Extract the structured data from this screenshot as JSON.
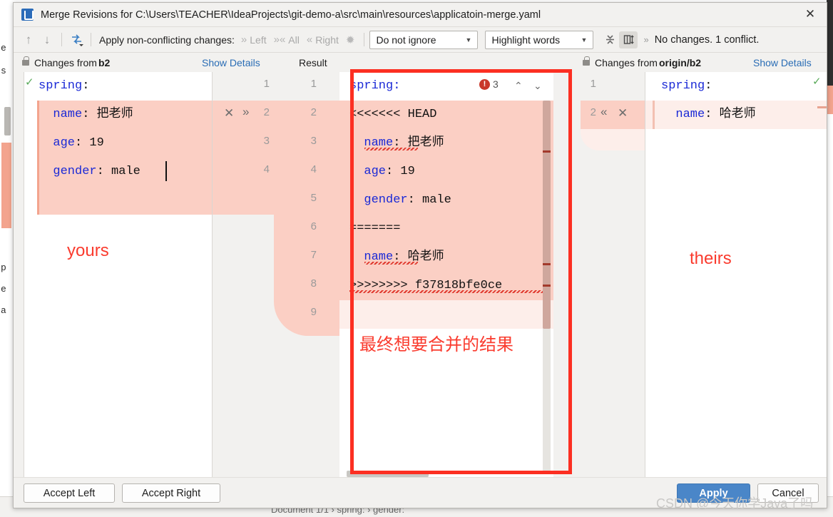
{
  "window": {
    "title": "Merge Revisions for C:\\Users\\TEACHER\\IdeaProjects\\git-demo-a\\src\\main\\resources\\applicatoin-merge.yaml",
    "close_label": "✕",
    "app_icon": "intellij-idea-icon"
  },
  "toolbar": {
    "prev_icon": "↑",
    "next_icon": "↓",
    "apply_all_icon": "⇆",
    "apply_label": "Apply non-conflicting changes:",
    "left_label": "Left",
    "left_icon": "»",
    "all_label": "All",
    "all_icon": "»«",
    "right_label": "Right",
    "right_icon": "«",
    "magic_icon": "magic-wand-icon",
    "ignore_select": "Do not ignore",
    "highlight_select": "Highlight words",
    "collapse_icon": "collapse-unchanged-icon",
    "sync_icon": "synchronize-scroll-icon",
    "overflow_icon": "»",
    "status": "No changes. 1 conflict."
  },
  "headers": {
    "left": {
      "prefix": "Changes from ",
      "branch": "b2",
      "details": "Show Details",
      "lock_icon": "lock-icon"
    },
    "result": "Result",
    "right": {
      "prefix": "Changes from ",
      "branch": "origin/b2",
      "details": "Show Details",
      "lock_icon": "lock-icon"
    }
  },
  "left_pane": {
    "name": "yours",
    "lines": [
      {
        "key": "spring",
        "colon": ":",
        "value": ""
      },
      {
        "key": "  name",
        "colon": ":",
        "value": " 把老师"
      },
      {
        "key": "  age",
        "colon": ":",
        "value": " 19"
      },
      {
        "key": "  gender",
        "colon": ":",
        "value": " male"
      }
    ],
    "line_numbers": [
      "1",
      "2",
      "3",
      "4"
    ],
    "gutter_icons": {
      "remove": "✕",
      "accept_right": "»"
    },
    "annotation": "yours"
  },
  "result_pane": {
    "lines": [
      "spring:",
      "<<<<<<< HEAD",
      "  name: 把老师",
      "  age: 19",
      "  gender: male",
      "=======",
      "  name: 哈老师",
      ">>>>>>>> f37818bfe0ce"
    ],
    "line_numbers": [
      "1",
      "2",
      "3",
      "4",
      "5",
      "6",
      "7",
      "8",
      "9"
    ],
    "error_count": "3",
    "error_icon": "error-icon",
    "nav_up": "⌃",
    "nav_down": "⌄",
    "annotation": "最终想要合并的结果"
  },
  "right_pane": {
    "name": "theirs",
    "lines": [
      {
        "key": "spring",
        "colon": ":",
        "value": ""
      },
      {
        "key": "  name",
        "colon": ":",
        "value": " 哈老师"
      }
    ],
    "line_numbers": [
      "1",
      "2"
    ],
    "gutter_icons": {
      "accept_left": "«",
      "remove": "✕"
    },
    "annotation": "theirs"
  },
  "footer": {
    "accept_left": "Accept Left",
    "accept_right": "Accept Right",
    "apply": "Apply",
    "cancel": "Cancel"
  },
  "watermark": "CSDN @今天你学Java了吗",
  "background": {
    "status_text": "Document 1/1   ›  spring:  ›  gender:",
    "edge_chars": [
      "e",
      "s",
      "p",
      "e",
      "a"
    ]
  },
  "colors": {
    "conflict_bg": "#fbcfc4",
    "conflict_light": "#fdeeea",
    "accent_red": "#fc2f22",
    "link": "#2a6db5",
    "keyword": "#1a29d6",
    "primary_button": "#4a86c8"
  }
}
